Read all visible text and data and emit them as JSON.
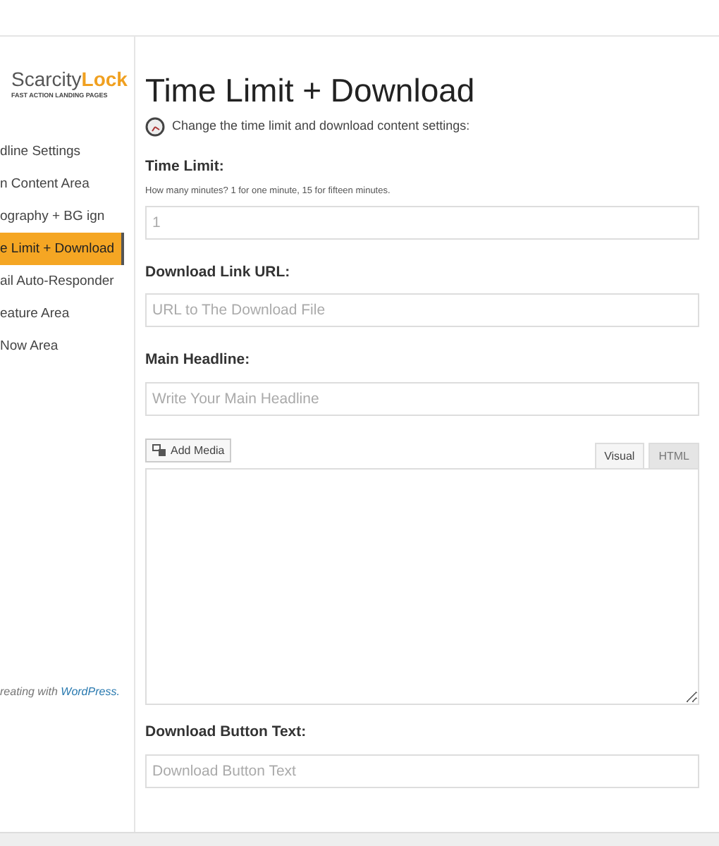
{
  "logo": {
    "name_start": "Scarcity",
    "name_end": "Lock",
    "tagline": "FAST ACTION LANDING PAGES"
  },
  "sidebar": {
    "items": [
      {
        "label": "dline Settings",
        "selected": false
      },
      {
        "label": "n Content Area",
        "selected": false
      },
      {
        "label": "ography + BG ign",
        "selected": false
      },
      {
        "label": "e Limit + Download",
        "selected": true
      },
      {
        "label": "ail Auto-Responder",
        "selected": false
      },
      {
        "label": "eature Area",
        "selected": false
      },
      {
        "label": "Now Area",
        "selected": false
      }
    ],
    "footer": {
      "text": "reating with ",
      "link": "WordPress."
    }
  },
  "page": {
    "title": "Time Limit + Download",
    "description": "Change the time limit and download content settings:"
  },
  "fields": [
    {
      "kind": "input",
      "label": "Time Limit:",
      "hint": "How many minutes? 1 for one minute, 15 for fifteen minutes.",
      "value": "1"
    },
    {
      "kind": "input",
      "label": "Download Link URL:",
      "placeholder": "URL to The Download File"
    },
    {
      "kind": "input",
      "label": "Main Headline:",
      "placeholder": "Write Your Main Headline"
    },
    {
      "kind": "editor",
      "add_media": "Add Media",
      "tabs": [
        {
          "label": "Visual",
          "selected": true
        },
        {
          "label": "HTML",
          "selected": false
        }
      ]
    },
    {
      "kind": "input",
      "label": "Download Button Text:",
      "placeholder": "Download Button Text"
    }
  ]
}
